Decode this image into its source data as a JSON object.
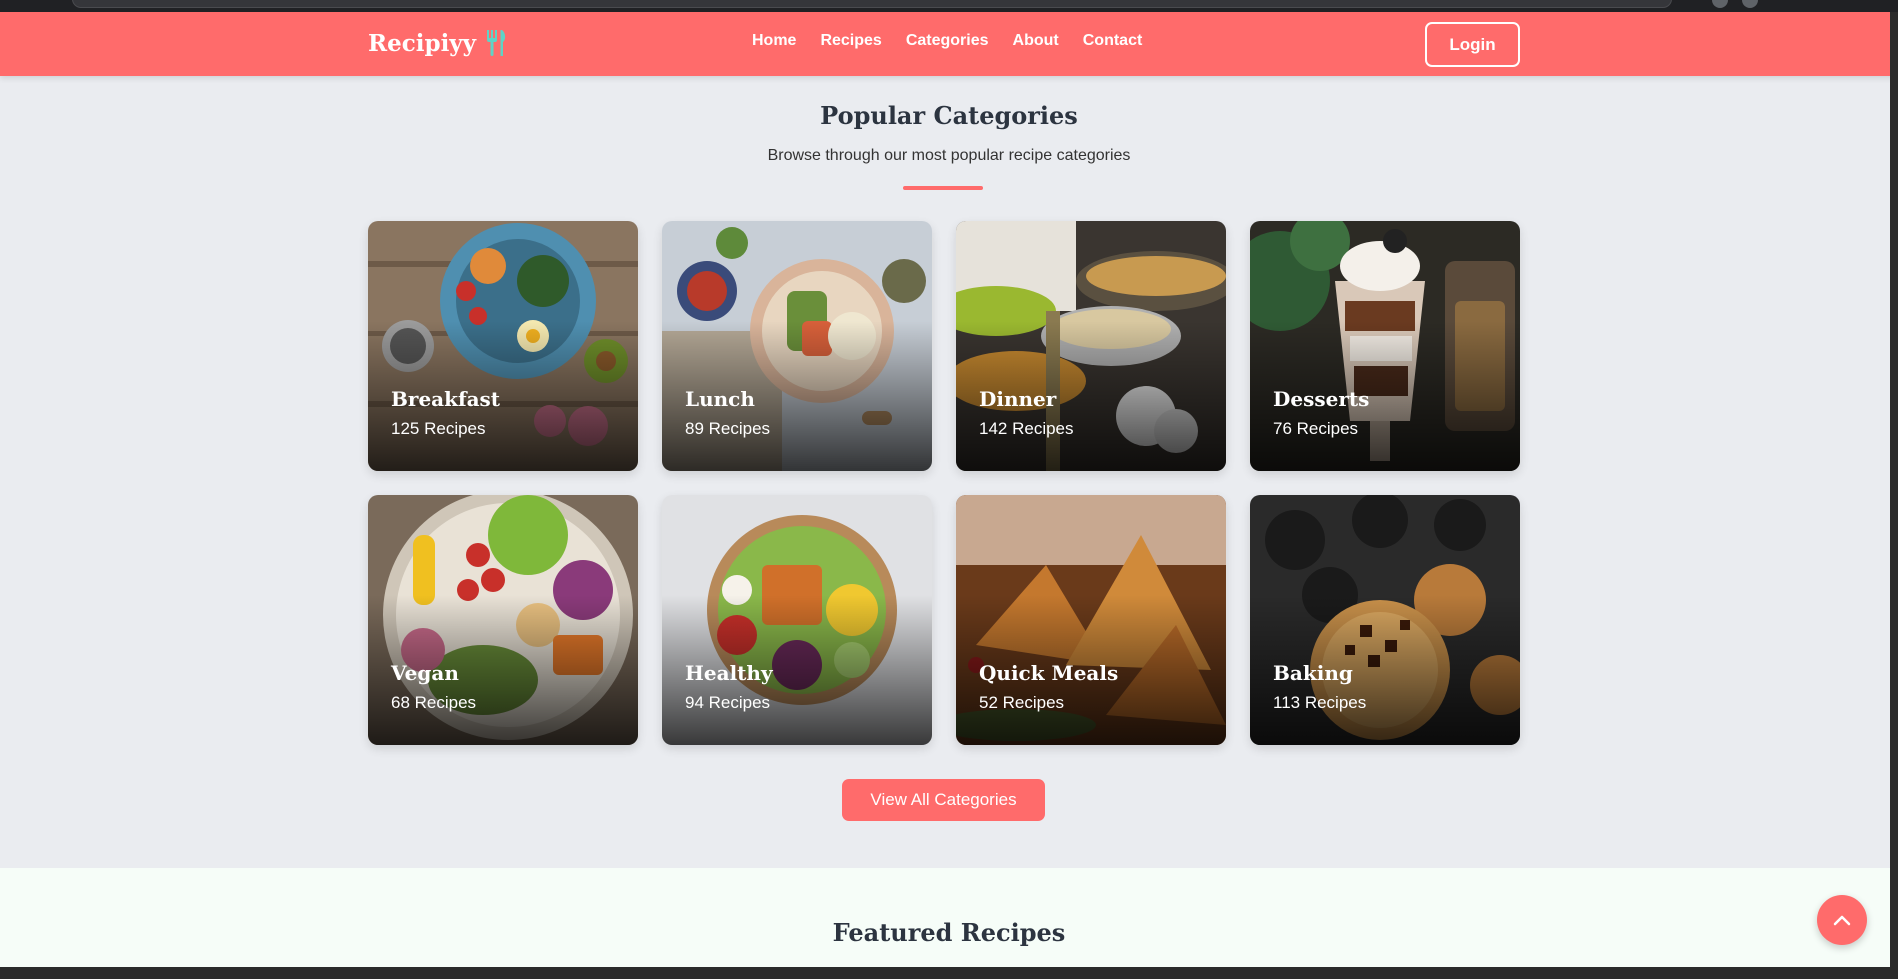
{
  "brand": {
    "name": "Recipiyy",
    "icon": "fork-knife-icon",
    "accent": "#ff6b6b",
    "icon_color": "#5fd3c6"
  },
  "nav": {
    "links": [
      "Home",
      "Recipes",
      "Categories",
      "About",
      "Contact"
    ],
    "login_label": "Login"
  },
  "categories_section": {
    "title": "Popular Categories",
    "subtitle": "Browse through our most popular recipe categories",
    "items": [
      {
        "name": "Breakfast",
        "count": "125 Recipes"
      },
      {
        "name": "Lunch",
        "count": "89 Recipes"
      },
      {
        "name": "Dinner",
        "count": "142 Recipes"
      },
      {
        "name": "Desserts",
        "count": "76 Recipes"
      },
      {
        "name": "Vegan",
        "count": "68 Recipes"
      },
      {
        "name": "Healthy",
        "count": "94 Recipes"
      },
      {
        "name": "Quick Meals",
        "count": "52 Recipes"
      },
      {
        "name": "Baking",
        "count": "113 Recipes"
      }
    ],
    "button_label": "View All Categories"
  },
  "featured_section": {
    "title": "Featured Recipes"
  },
  "back_to_top": {
    "icon": "chevron-up-icon"
  }
}
